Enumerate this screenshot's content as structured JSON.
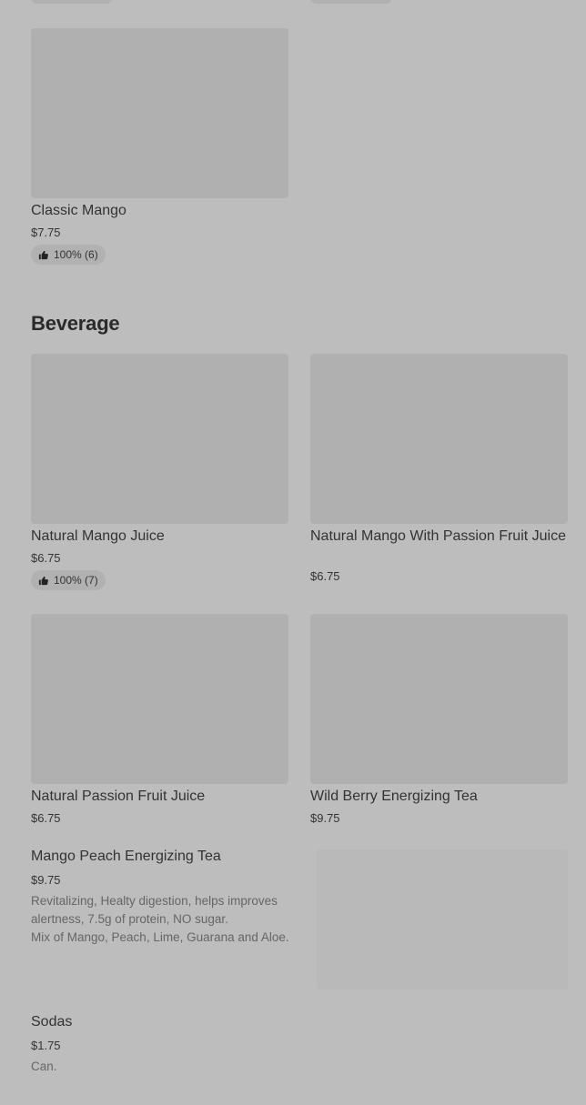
{
  "sections": [
    {
      "heading": "",
      "items": [
        {
          "name": "Classic Mango",
          "price": "$7.75",
          "rating": "100% (6)"
        }
      ]
    },
    {
      "heading": "Beverage",
      "items": [
        {
          "name": "Natural Mango Juice",
          "price": "$6.75",
          "rating": "100% (7)"
        },
        {
          "name": "Natural Mango With Passion Fruit Juice",
          "price": "$6.75"
        },
        {
          "name": "Natural Passion Fruit Juice",
          "price": "$6.75"
        },
        {
          "name": "Wild Berry Energizing Tea",
          "price": "$9.75"
        },
        {
          "name": "Mango Peach Energizing Tea",
          "price": "$9.75",
          "description_line1": "Revitalizing, Healty digestion, helps improves alertness, 7.5g of protein, NO sugar.",
          "description_line2": "Mix of Mango, Peach, Lime, Guarana and Aloe."
        },
        {
          "name": "Sodas",
          "price": "$1.75",
          "description_line1": "Can."
        }
      ]
    }
  ],
  "icons": {
    "rating": "thumbs-up-icon"
  }
}
